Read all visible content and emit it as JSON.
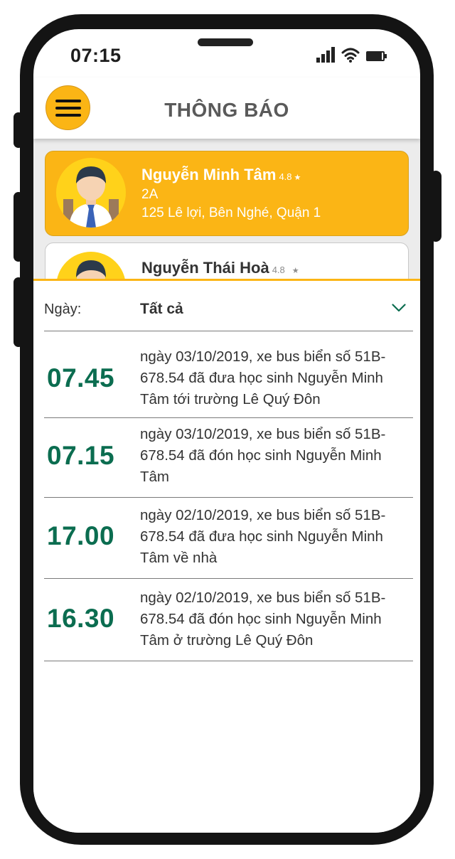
{
  "status_bar": {
    "time": "07:15"
  },
  "header": {
    "title": "THÔNG BÁO"
  },
  "students": [
    {
      "name": "Nguyễn Minh Tâm",
      "rating": "4.8",
      "class": "2A",
      "address": "125 Lê lợi, Bên Nghé, Quận 1",
      "active": true
    },
    {
      "name": "Nguyễn Thái Hoà",
      "rating": "4.8",
      "active": false
    }
  ],
  "filter": {
    "label": "Ngày:",
    "value": "Tất cả"
  },
  "notifications": [
    {
      "time": "07.45",
      "text": "ngày 03/10/2019, xe bus biển số 51B-678.54 đã đưa học sinh Nguyễn Minh Tâm tới trường Lê Quý Đôn"
    },
    {
      "time": "07.15",
      "text": "ngày 03/10/2019, xe bus biển số 51B-678.54 đã đón học sinh Nguyễn Minh Tâm"
    },
    {
      "time": "17.00",
      "text": "ngày 02/10/2019, xe bus biển số 51B-678.54 đã đưa học sinh Nguyễn Minh Tâm về nhà"
    },
    {
      "time": "16.30",
      "text": "ngày 02/10/2019, xe bus biển số 51B-678.54 đã đón học sinh Nguyễn Minh Tâm ở trường Lê Quý Đôn"
    }
  ],
  "colors": {
    "accent": "#fbb515",
    "time_green": "#0b6d50",
    "frame": "#141414"
  },
  "icons": [
    "menu-icon",
    "signal-icon",
    "wifi-icon",
    "battery-icon",
    "chevron-down-icon",
    "star-icon"
  ]
}
